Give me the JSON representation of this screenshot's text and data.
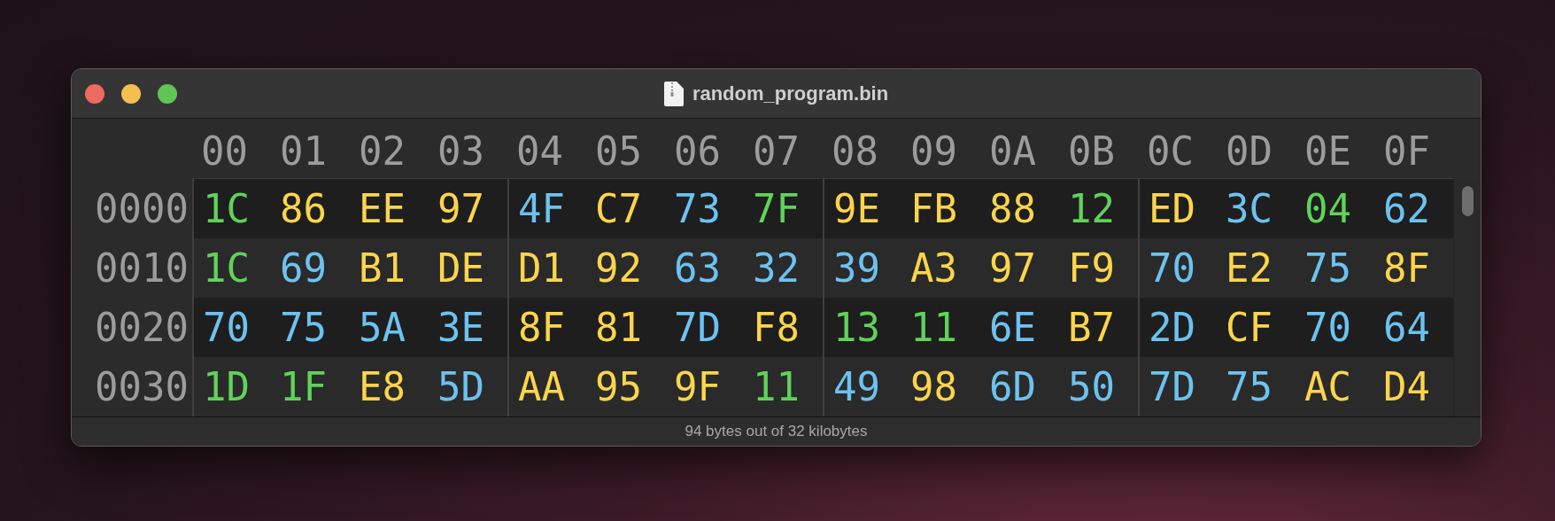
{
  "window": {
    "title": "random_program.bin"
  },
  "columns": [
    "00",
    "01",
    "02",
    "03",
    "04",
    "05",
    "06",
    "07",
    "08",
    "09",
    "0A",
    "0B",
    "0C",
    "0D",
    "0E",
    "0F"
  ],
  "rows": [
    {
      "address": "0000",
      "bytes": [
        {
          "value": "1C",
          "color": "#5fd35a"
        },
        {
          "value": "86",
          "color": "#fcd54a"
        },
        {
          "value": "EE",
          "color": "#fcd54a"
        },
        {
          "value": "97",
          "color": "#fcd54a"
        },
        {
          "value": "4F",
          "color": "#6cc2f0"
        },
        {
          "value": "C7",
          "color": "#fcd54a"
        },
        {
          "value": "73",
          "color": "#6cc2f0"
        },
        {
          "value": "7F",
          "color": "#5fd35a"
        },
        {
          "value": "9E",
          "color": "#fcd54a"
        },
        {
          "value": "FB",
          "color": "#fcd54a"
        },
        {
          "value": "88",
          "color": "#fcd54a"
        },
        {
          "value": "12",
          "color": "#5fd35a"
        },
        {
          "value": "ED",
          "color": "#fcd54a"
        },
        {
          "value": "3C",
          "color": "#6cc2f0"
        },
        {
          "value": "04",
          "color": "#5fd35a"
        },
        {
          "value": "62",
          "color": "#6cc2f0"
        }
      ]
    },
    {
      "address": "0010",
      "bytes": [
        {
          "value": "1C",
          "color": "#5fd35a"
        },
        {
          "value": "69",
          "color": "#6cc2f0"
        },
        {
          "value": "B1",
          "color": "#fcd54a"
        },
        {
          "value": "DE",
          "color": "#fcd54a"
        },
        {
          "value": "D1",
          "color": "#fcd54a"
        },
        {
          "value": "92",
          "color": "#fcd54a"
        },
        {
          "value": "63",
          "color": "#6cc2f0"
        },
        {
          "value": "32",
          "color": "#6cc2f0"
        },
        {
          "value": "39",
          "color": "#6cc2f0"
        },
        {
          "value": "A3",
          "color": "#fcd54a"
        },
        {
          "value": "97",
          "color": "#fcd54a"
        },
        {
          "value": "F9",
          "color": "#fcd54a"
        },
        {
          "value": "70",
          "color": "#6cc2f0"
        },
        {
          "value": "E2",
          "color": "#fcd54a"
        },
        {
          "value": "75",
          "color": "#6cc2f0"
        },
        {
          "value": "8F",
          "color": "#fcd54a"
        }
      ]
    },
    {
      "address": "0020",
      "bytes": [
        {
          "value": "70",
          "color": "#6cc2f0"
        },
        {
          "value": "75",
          "color": "#6cc2f0"
        },
        {
          "value": "5A",
          "color": "#6cc2f0"
        },
        {
          "value": "3E",
          "color": "#6cc2f0"
        },
        {
          "value": "8F",
          "color": "#fcd54a"
        },
        {
          "value": "81",
          "color": "#fcd54a"
        },
        {
          "value": "7D",
          "color": "#6cc2f0"
        },
        {
          "value": "F8",
          "color": "#fcd54a"
        },
        {
          "value": "13",
          "color": "#5fd35a"
        },
        {
          "value": "11",
          "color": "#5fd35a"
        },
        {
          "value": "6E",
          "color": "#6cc2f0"
        },
        {
          "value": "B7",
          "color": "#fcd54a"
        },
        {
          "value": "2D",
          "color": "#6cc2f0"
        },
        {
          "value": "CF",
          "color": "#fcd54a"
        },
        {
          "value": "70",
          "color": "#6cc2f0"
        },
        {
          "value": "64",
          "color": "#6cc2f0"
        }
      ]
    },
    {
      "address": "0030",
      "bytes": [
        {
          "value": "1D",
          "color": "#5fd35a"
        },
        {
          "value": "1F",
          "color": "#5fd35a"
        },
        {
          "value": "E8",
          "color": "#fcd54a"
        },
        {
          "value": "5D",
          "color": "#6cc2f0"
        },
        {
          "value": "AA",
          "color": "#fcd54a"
        },
        {
          "value": "95",
          "color": "#fcd54a"
        },
        {
          "value": "9F",
          "color": "#fcd54a"
        },
        {
          "value": "11",
          "color": "#5fd35a"
        },
        {
          "value": "49",
          "color": "#6cc2f0"
        },
        {
          "value": "98",
          "color": "#fcd54a"
        },
        {
          "value": "6D",
          "color": "#6cc2f0"
        },
        {
          "value": "50",
          "color": "#6cc2f0"
        },
        {
          "value": "7D",
          "color": "#6cc2f0"
        },
        {
          "value": "75",
          "color": "#6cc2f0"
        },
        {
          "value": "AC",
          "color": "#fcd54a"
        },
        {
          "value": "D4",
          "color": "#fcd54a"
        }
      ]
    }
  ],
  "status_bar": "94 bytes out of 32 kilobytes"
}
